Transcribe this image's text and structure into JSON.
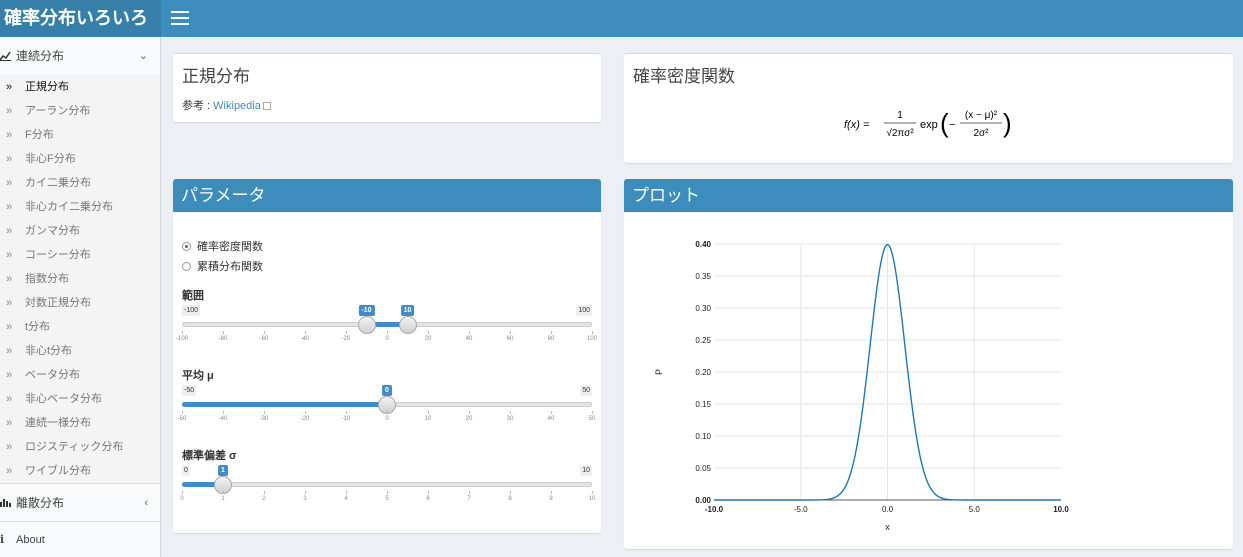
{
  "app": {
    "title": "確率分布いろいろ"
  },
  "sidebar": {
    "continuous": {
      "label": "連続分布"
    },
    "items": [
      {
        "label": "正規分布"
      },
      {
        "label": "アーラン分布"
      },
      {
        "label": "F分布"
      },
      {
        "label": "非心F分布"
      },
      {
        "label": "カイ二乗分布"
      },
      {
        "label": "非心カイ二乗分布"
      },
      {
        "label": "ガンマ分布"
      },
      {
        "label": "コーシー分布"
      },
      {
        "label": "指数分布"
      },
      {
        "label": "対数正規分布"
      },
      {
        "label": "t分布"
      },
      {
        "label": "非心t分布"
      },
      {
        "label": "ベータ分布"
      },
      {
        "label": "非心ベータ分布"
      },
      {
        "label": "連続一様分布"
      },
      {
        "label": "ロジスティック分布"
      },
      {
        "label": "ワイブル分布"
      }
    ],
    "discrete": {
      "label": "離散分布"
    },
    "about": {
      "label": "About"
    }
  },
  "info_box": {
    "title": "正規分布",
    "ref_label": "参考 : ",
    "ref_link": "Wikipedia"
  },
  "pdf_box": {
    "title": "確率密度関数",
    "formula": {
      "lhs": "f(x) =",
      "num": "1",
      "den": "√2πσ²",
      "exp": "exp",
      "inner_num": "(x − μ)²",
      "inner_den": "2σ²",
      "minus": "−"
    }
  },
  "params_box": {
    "title": "パラメータ",
    "radio": [
      {
        "label": "確率密度関数",
        "checked": true
      },
      {
        "label": "累積分布関数",
        "checked": false
      }
    ],
    "range": {
      "label": "範囲",
      "min_label": "-100",
      "max_label": "100",
      "low": -10,
      "high": 10,
      "low_label": "-10",
      "high_label": "10",
      "ticks": [
        "-100",
        "-80",
        "-60",
        "-40",
        "-20",
        "0",
        "20",
        "40",
        "60",
        "80",
        "100"
      ]
    },
    "mean": {
      "label": "平均 μ",
      "min_label": "-50",
      "max_label": "50",
      "value": 0,
      "value_label": "0",
      "ticks": [
        "-50",
        "-40",
        "-30",
        "-20",
        "-10",
        "0",
        "10",
        "20",
        "30",
        "40",
        "50"
      ]
    },
    "sd": {
      "label": "標準偏差 σ",
      "min_label": "0",
      "max_label": "10",
      "value": 1,
      "value_label": "1",
      "ticks": [
        "0",
        "1",
        "2",
        "3",
        "4",
        "5",
        "6",
        "7",
        "8",
        "9",
        "10"
      ]
    }
  },
  "plot_box": {
    "title": "プロット"
  },
  "chart_data": {
    "type": "line",
    "title": "",
    "xlabel": "x",
    "ylabel": "P",
    "xlim": [
      -10,
      10
    ],
    "ylim": [
      0,
      0.4
    ],
    "x_ticks": [
      "-10.0",
      "-5.0",
      "0.0",
      "5.0",
      "10.0"
    ],
    "y_ticks": [
      "0.00",
      "0.05",
      "0.10",
      "0.15",
      "0.20",
      "0.25",
      "0.30",
      "0.35",
      "0.40"
    ],
    "series": [
      {
        "mean": 0,
        "sd": 1,
        "color": "#1f77b4"
      }
    ],
    "grid": true
  }
}
